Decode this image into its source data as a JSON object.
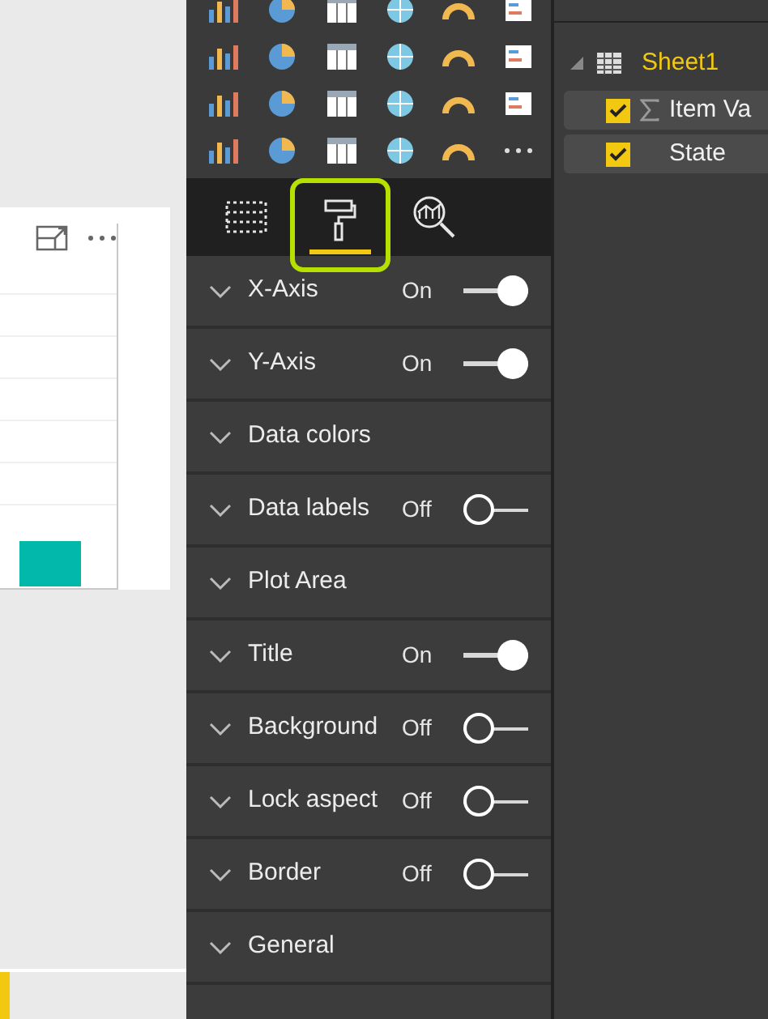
{
  "tabs": [
    {
      "kind": "fields",
      "selected": false
    },
    {
      "kind": "format",
      "selected": true
    },
    {
      "kind": "analytics",
      "selected": false
    }
  ],
  "format_sections": [
    {
      "label": "X-Axis",
      "toggle": {
        "label": "On",
        "on": true
      }
    },
    {
      "label": "Y-Axis",
      "toggle": {
        "label": "On",
        "on": true
      }
    },
    {
      "label": "Data colors"
    },
    {
      "label": "Data labels",
      "toggle": {
        "label": "Off",
        "on": false
      }
    },
    {
      "label": "Plot Area"
    },
    {
      "label": "Title",
      "toggle": {
        "label": "On",
        "on": true
      }
    },
    {
      "label": "Background",
      "toggle": {
        "label": "Off",
        "on": false
      }
    },
    {
      "label": "Lock aspect",
      "toggle": {
        "label": "Off",
        "on": false
      }
    },
    {
      "label": "Border",
      "toggle": {
        "label": "Off",
        "on": false
      }
    },
    {
      "label": "General"
    }
  ],
  "fields_pane": {
    "table": "Sheet1",
    "expanded": true,
    "fields": [
      {
        "label": "Item Va",
        "kind": "measure",
        "checked": true
      },
      {
        "label": "State",
        "kind": "field",
        "checked": true
      }
    ]
  }
}
